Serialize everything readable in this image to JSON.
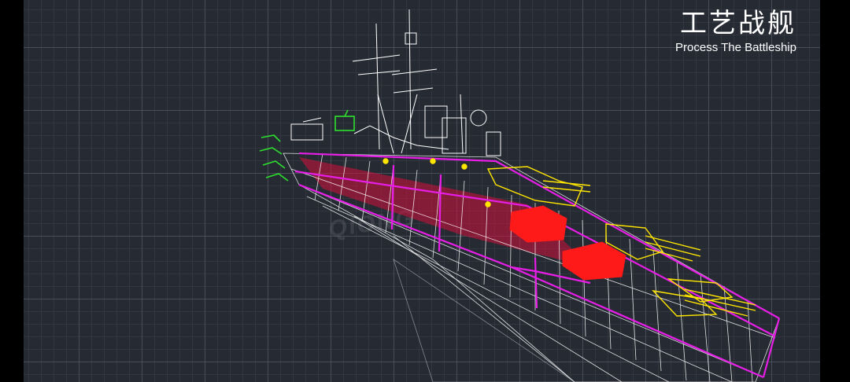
{
  "title": {
    "chinese": "工艺战舰",
    "english": "Process The Battleship"
  },
  "watermark": "QIONG",
  "colors": {
    "background": "#262a33",
    "wire": "#ffffff",
    "hull_frame": "#e61ee6",
    "turret": "#ff1a1a",
    "guns": "#ffe600",
    "bow": "#2de02d"
  }
}
